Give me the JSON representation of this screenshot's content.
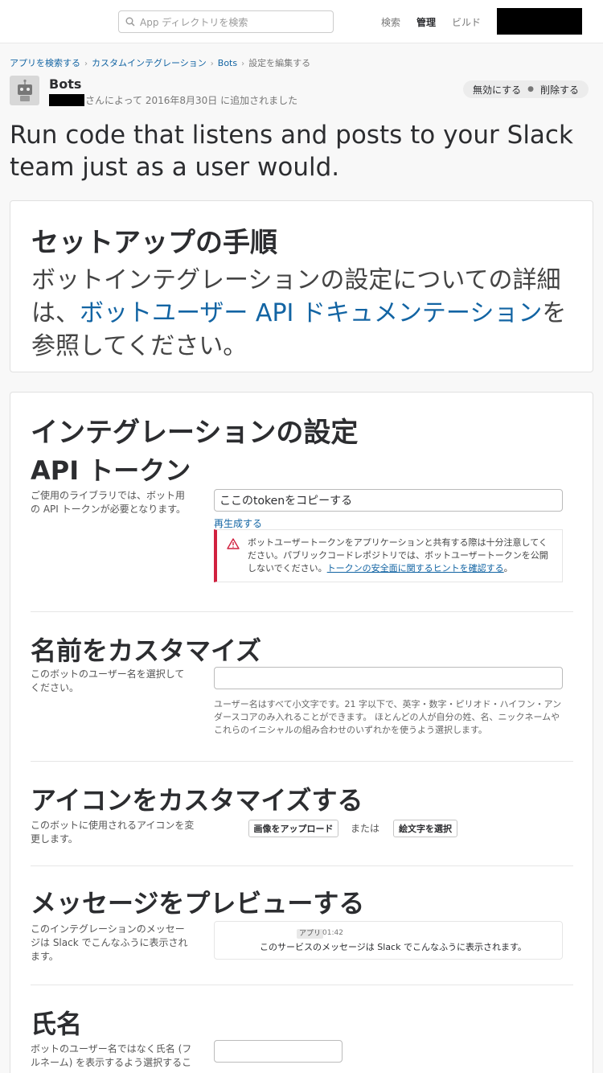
{
  "topbar": {
    "search_placeholder": "App ディレクトリを検索",
    "nav": [
      "検索",
      "管理",
      "ビルド"
    ]
  },
  "breadcrumb": [
    "アプリを検索する",
    "カスタムインテグレーション",
    "Bots",
    "設定を編集する"
  ],
  "app": {
    "name": "Bots",
    "added_by": "さんによって 2016年8月30日 に追加されました",
    "disable_label": "無効にする",
    "delete_label": "削除する"
  },
  "headline": "Run code that listens and posts to your Slack team just as a user would.",
  "setup": {
    "title": "セットアップの手順",
    "text_before": "ボットインテグレーションの設定についての詳細は、",
    "link": "ボットユーザー API ドキュメンテーション",
    "text_after": "を参照してください。"
  },
  "settings": {
    "title": "インテグレーションの設定",
    "token": {
      "heading": "API トークン",
      "desc": "ご使用のライブラリでは、ボット用の API トークンが必要となります。",
      "value": "ここのtokenをコピーする",
      "regenerate": "再生成する",
      "warning": "ボットユーザートークンをアプリケーションと共有する際は十分注意してください。パブリックコードレポジトリでは、ボットユーザートークンを公開しないでください。",
      "warning_link": "トークンの安全面に関するヒントを確認する",
      "warning_end": "。"
    },
    "name": {
      "heading": "名前をカスタマイズ",
      "desc": "このボットのユーザー名を選択してください。",
      "value": "",
      "hint": "ユーザー名はすべて小文字です。21 字以下で、英字・数字・ピリオド・ハイフン・アンダースコアのみ入れることができます。 ほとんどの人が自分の姓、名、ニックネームやこれらのイニシャルの組み合わせのいずれかを使うよう選択します。"
    },
    "icon": {
      "heading": "アイコンをカスタマイズする",
      "desc": "このボットに使用されるアイコンを変更します。",
      "upload_label": "画像をアップロード",
      "or_label": "または",
      "emoji_label": "絵文字を選択"
    },
    "preview": {
      "heading": "メッセージをプレビューする",
      "desc": "このインテグレーションのメッセージは Slack でこんなふうに表示されます。",
      "badge": "アプリ",
      "time": "01:42",
      "message": "このサービスのメッセージは Slack でこんなふうに表示されます。"
    },
    "fullname": {
      "heading": "氏名",
      "desc": "ボットのユーザー名ではなく氏名 (フルネーム) を表示するよう選択するこ",
      "value": ""
    }
  }
}
